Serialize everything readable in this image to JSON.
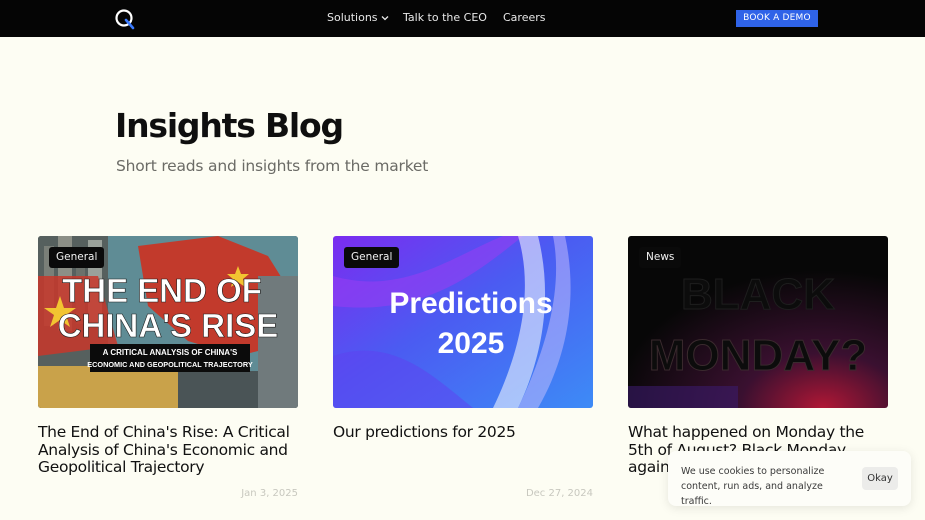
{
  "nav": {
    "solutions": "Solutions",
    "ceo": "Talk to the CEO",
    "careers": "Careers",
    "cta": "BOOK A DEMO"
  },
  "hero": {
    "title": "Insights Blog",
    "subtitle": "Short reads and insights from the market"
  },
  "posts": [
    {
      "tag": "General",
      "title": "The End of China's Rise: A Critical Analysis of China's Economic and Geopolitical Trajectory",
      "date": "Jan 3, 2025",
      "image_text": {
        "headline_line1": "THE END OF",
        "headline_line2": "CHINA'S RISE",
        "sub_line1": "A CRITICAL ANALYSIS OF CHINA'S",
        "sub_line2": "ECONOMIC AND GEOPOLITICAL TRAJECTORY"
      }
    },
    {
      "tag": "General",
      "title": "Our predictions for 2025",
      "date": "Dec 27, 2024",
      "image_text": {
        "line1": "Predictions",
        "line2": "2025"
      }
    },
    {
      "tag": "News",
      "title": "What happened on Monday the 5th of August? Black Monday again?",
      "date": "",
      "image_text": {
        "line1": "BLACK",
        "line2": "MONDAY?"
      }
    }
  ],
  "cookie": {
    "text": "We use cookies to personalize content, run ads, and analyze traffic.",
    "button": "Okay"
  },
  "colors": {
    "nav_bg": "#050505",
    "page_bg": "#fdfdf3",
    "cta": "#2f63e8"
  }
}
